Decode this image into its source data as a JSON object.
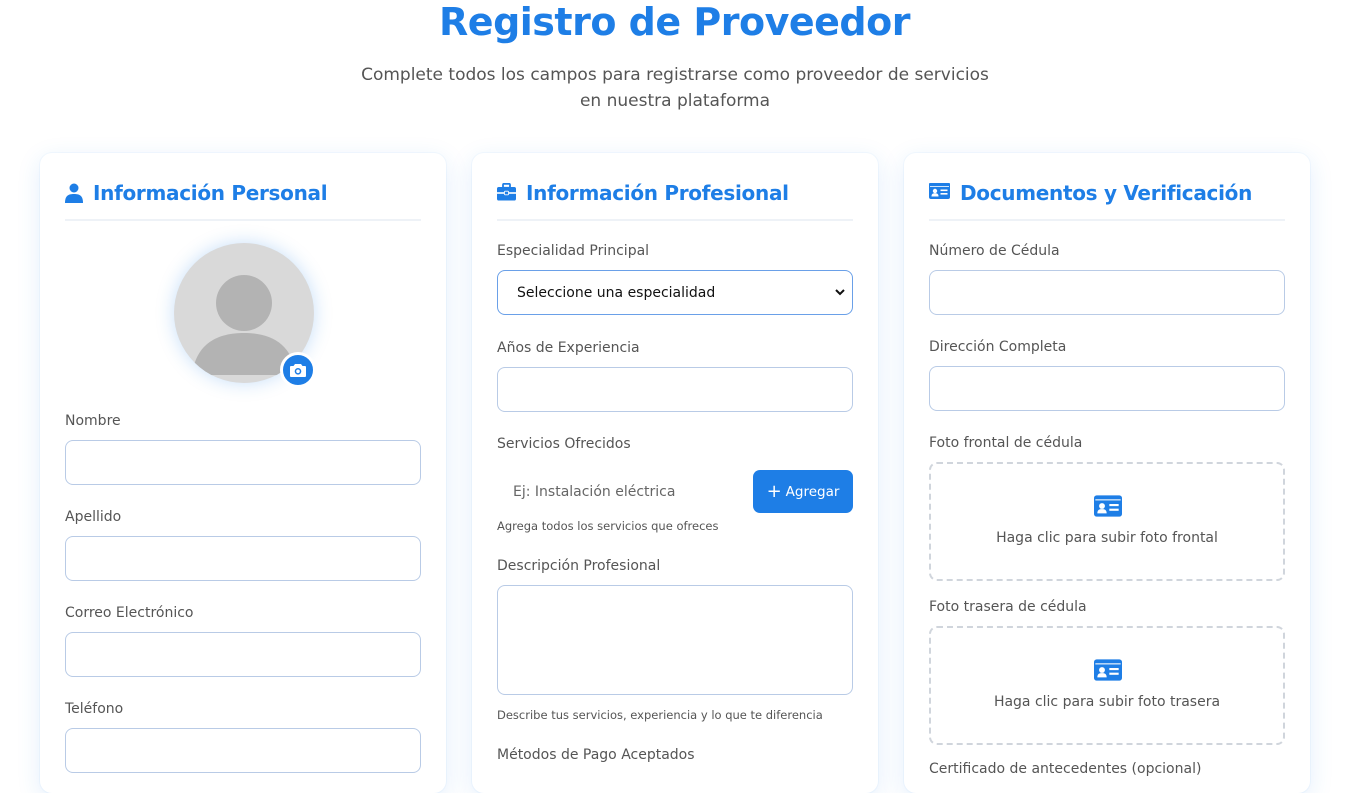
{
  "header": {
    "title": "Registro de Proveedor",
    "subtitle_line1": "Complete todos los campos para registrarse como proveedor de servicios",
    "subtitle_line2": "en nuestra plataforma"
  },
  "personal": {
    "title": "Información Personal",
    "icon": "user-icon",
    "photo_icon": "camera-icon",
    "fields": {
      "nombre": {
        "label": "Nombre",
        "value": ""
      },
      "apellido": {
        "label": "Apellido",
        "value": ""
      },
      "correo": {
        "label": "Correo Electrónico",
        "value": ""
      },
      "telefono": {
        "label": "Teléfono",
        "value": ""
      }
    }
  },
  "profesional": {
    "title": "Información Profesional",
    "icon": "briefcase-icon",
    "especialidad": {
      "label": "Especialidad Principal",
      "selected": "Seleccione una especialidad"
    },
    "experiencia": {
      "label": "Años de Experiencia",
      "value": ""
    },
    "servicios": {
      "label": "Servicios Ofrecidos",
      "placeholder": "Ej: Instalación eléctrica",
      "add_button": "Agregar",
      "hint": "Agrega todos los servicios que ofreces"
    },
    "descripcion": {
      "label": "Descripción Profesional",
      "value": "",
      "hint": "Describe tus servicios, experiencia y lo que te diferencia"
    },
    "pagos": {
      "label": "Métodos de Pago Aceptados"
    }
  },
  "documentos": {
    "title": "Documentos y Verificación",
    "icon": "id-card-icon",
    "cedula": {
      "label": "Número de Cédula",
      "value": ""
    },
    "direccion": {
      "label": "Dirección Completa",
      "value": ""
    },
    "foto_frontal": {
      "label": "Foto frontal de cédula",
      "upload_text": "Haga clic para subir foto frontal"
    },
    "foto_trasera": {
      "label": "Foto trasera de cédula",
      "upload_text": "Haga clic para subir foto trasera"
    },
    "certificado": {
      "label": "Certificado de antecedentes (opcional)"
    }
  },
  "colors": {
    "accent": "#1e7ee6",
    "field_border": "#b9cbe6",
    "text": "#555555"
  }
}
